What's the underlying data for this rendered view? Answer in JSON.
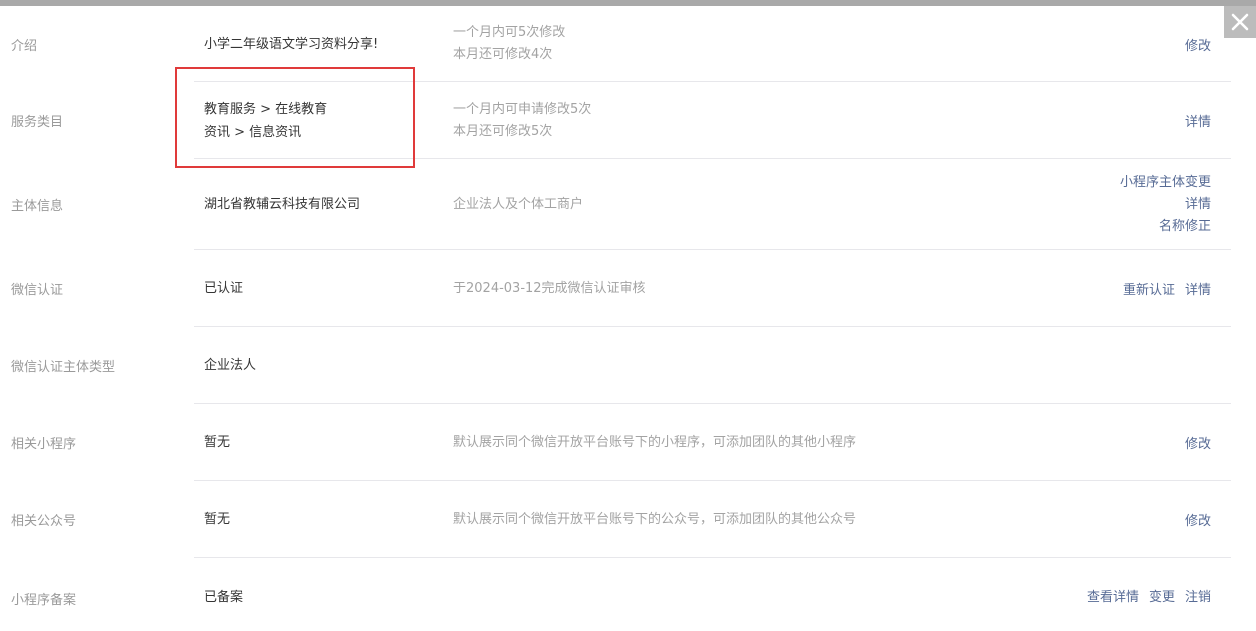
{
  "rows": [
    {
      "label": "介绍",
      "value": [
        "小学二年级语文学习资料分享!"
      ],
      "desc": [
        "一个月内可5次修改",
        "本月还可修改4次"
      ],
      "actions": [
        "修改"
      ]
    },
    {
      "label": "服务类目",
      "value": [
        "教育服务 > 在线教育",
        "资讯 > 信息资讯"
      ],
      "desc": [
        "一个月内可申请修改5次",
        "本月还可修改5次"
      ],
      "actions": [
        "详情"
      ]
    },
    {
      "label": "主体信息",
      "value": [
        "湖北省教辅云科技有限公司"
      ],
      "desc": [
        "企业法人及个体工商户"
      ],
      "actions": [
        "小程序主体变更",
        "详情",
        "名称修正"
      ]
    },
    {
      "label": "微信认证",
      "value": [
        "已认证"
      ],
      "desc": [
        "于2024-03-12完成微信认证审核"
      ],
      "actions": [
        "重新认证",
        "详情"
      ]
    },
    {
      "label": "微信认证主体类型",
      "value": [
        "企业法人"
      ],
      "desc": [],
      "actions": []
    },
    {
      "label": "相关小程序",
      "value": [
        "暂无"
      ],
      "desc": [
        "默认展示同个微信开放平台账号下的小程序，可添加团队的其他小程序"
      ],
      "actions": [
        "修改"
      ]
    },
    {
      "label": "相关公众号",
      "value": [
        "暂无"
      ],
      "desc": [
        "默认展示同个微信开放平台账号下的公众号，可添加团队的其他公众号"
      ],
      "actions": [
        "修改"
      ]
    },
    {
      "label": "小程序备案",
      "value": [
        "已备案"
      ],
      "desc": [],
      "actions": [
        "查看详情",
        "变更",
        "注销"
      ]
    }
  ],
  "colors": {
    "link": "#576b95",
    "highlight": "#e03a3a",
    "label": "#9a9a9a",
    "desc": "#a3a3a3"
  },
  "icons": {
    "close": "close-icon"
  }
}
